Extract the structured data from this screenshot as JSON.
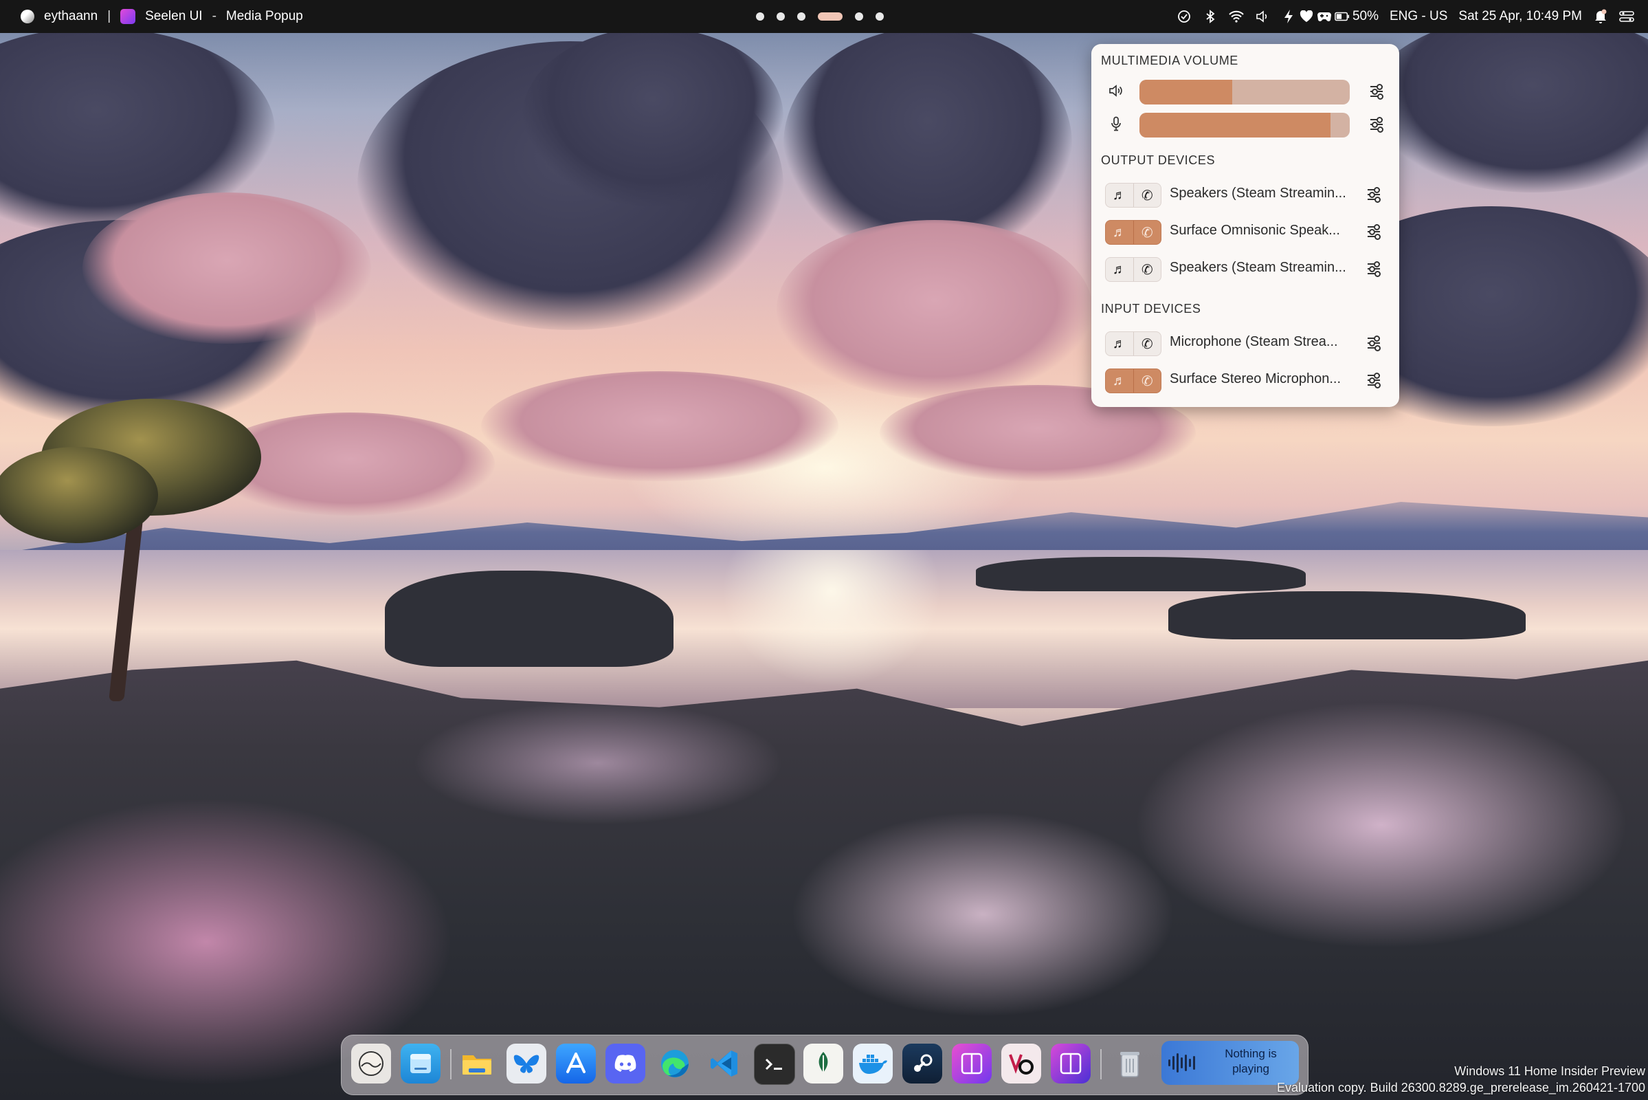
{
  "topbar": {
    "user": "eythaann",
    "divider": "|",
    "app_name": "Seelen UI",
    "dash": "-",
    "window_title": "Media Popup",
    "battery": "50%",
    "language": "ENG - US",
    "datetime": "Sat 25 Apr, 10:49 PM",
    "icons": [
      "clock-check-icon",
      "bluetooth-icon",
      "wifi-icon",
      "volume-icon",
      "power-icon",
      "heart-icon",
      "gamepad-icon",
      "battery-icon",
      "notification-bell-icon",
      "settings-toggle-icon"
    ]
  },
  "workspaces": {
    "count": 6,
    "active_index": 3
  },
  "popup": {
    "multimedia_title": "MULTIMEDIA VOLUME",
    "output_volume": 0.44,
    "input_volume": 0.91,
    "output_title": "OUTPUT DEVICES",
    "input_title": "INPUT DEVICES",
    "output_devices": [
      {
        "label": "Speakers (Steam Streamin...",
        "active": false
      },
      {
        "label": "Surface Omnisonic Speak...",
        "active": true
      },
      {
        "label": "Speakers (Steam Streamin...",
        "active": false
      }
    ],
    "input_devices": [
      {
        "label": "Microphone (Steam Strea...",
        "active": false
      },
      {
        "label": "Surface Stereo Microphon...",
        "active": true
      }
    ],
    "colors": {
      "accent": "#ce8a63",
      "track": "#d3b2a3"
    }
  },
  "dock": {
    "apps": [
      "user-avatar-icon",
      "file-explorer-icon",
      "folder-icon",
      "bluesky-icon",
      "app-store-icon",
      "discord-icon",
      "edge-icon",
      "vscode-icon",
      "terminal-icon",
      "leaf-app-icon",
      "docker-icon",
      "steam-icon",
      "seelen-ui-icon",
      "virtualcam-icon",
      "seelen-ui-dev-icon",
      "recycle-bin-icon"
    ],
    "media_status": "Nothing is playing"
  },
  "watermark": {
    "line1": "Windows 11 Home Insider Preview",
    "line2": "Evaluation copy. Build 26300.8289.ge_prerelease_im.260421-1700"
  }
}
